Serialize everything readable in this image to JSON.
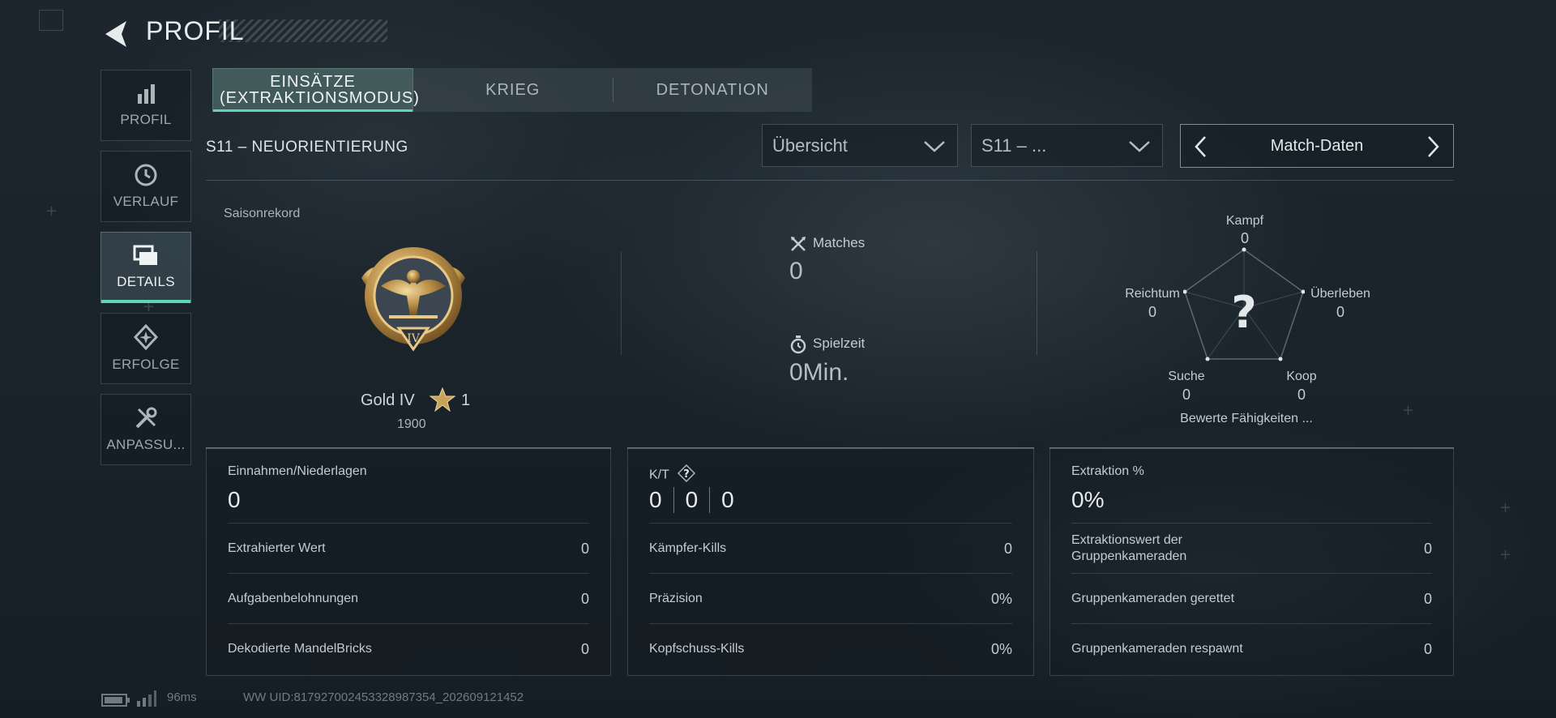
{
  "header": {
    "title": "PROFIL"
  },
  "sidebar": {
    "items": [
      {
        "label": "PROFIL",
        "icon": "bar-chart-icon"
      },
      {
        "label": "VERLAUF",
        "icon": "history-icon"
      },
      {
        "label": "DETAILS",
        "icon": "folders-icon",
        "active": true
      },
      {
        "label": "ERFOLGE",
        "icon": "achievement-icon"
      },
      {
        "label": "ANPASSU...",
        "icon": "tools-icon"
      }
    ]
  },
  "tabs": [
    {
      "label": "EINSÄTZE (EXTRAKTIONSMODUS)",
      "active": true
    },
    {
      "label": "KRIEG"
    },
    {
      "label": "DETONATION"
    }
  ],
  "season": {
    "title": "S11 – NEUORIENTIERUNG",
    "view_select": "Übersicht",
    "season_select": "S11 – ...",
    "match_data_label": "Match-Daten"
  },
  "record": {
    "label": "Saisonrekord",
    "rank_name": "Gold IV",
    "rank_numeral": "IV",
    "stars": "1",
    "points": "1900"
  },
  "summary": {
    "matches_label": "Matches",
    "matches_value": "0",
    "playtime_label": "Spielzeit",
    "playtime_value": "0Min."
  },
  "radar": {
    "center_symbol": "?",
    "axes": [
      {
        "label": "Kampf",
        "value": "0"
      },
      {
        "label": "Überleben",
        "value": "0"
      },
      {
        "label": "Koop",
        "value": "0"
      },
      {
        "label": "Suche",
        "value": "0"
      },
      {
        "label": "Reichtum",
        "value": "0"
      }
    ],
    "rate_label": "Bewerte Fähigkeiten ..."
  },
  "cards": {
    "income": {
      "title": "Einnahmen/Niederlagen",
      "value": "0",
      "rows": [
        {
          "label": "Extrahierter Wert",
          "value": "0"
        },
        {
          "label": "Aufgabenbelohnungen",
          "value": "0"
        },
        {
          "label": "Dekodierte MandelBricks",
          "value": "0"
        }
      ]
    },
    "kd": {
      "title": "K/T",
      "values": [
        "0",
        "0",
        "0"
      ],
      "rows": [
        {
          "label": "Kämpfer-Kills",
          "value": "0"
        },
        {
          "label": "Präzision",
          "value": "0%"
        },
        {
          "label": "Kopfschuss-Kills",
          "value": "0%"
        }
      ]
    },
    "extraction": {
      "title": "Extraktion %",
      "value": "0%",
      "rows": [
        {
          "label": "Extraktionswert der Gruppenkameraden",
          "value": "0"
        },
        {
          "label": "Gruppenkameraden gerettet",
          "value": "0"
        },
        {
          "label": "Gruppenkameraden respawnt",
          "value": "0"
        }
      ]
    }
  },
  "footer": {
    "ping": "96ms",
    "uid": "WW UID:817927002453328987354_202609121452"
  },
  "colors": {
    "accent": "#5fd6b3",
    "gold": "#c9a25a"
  }
}
